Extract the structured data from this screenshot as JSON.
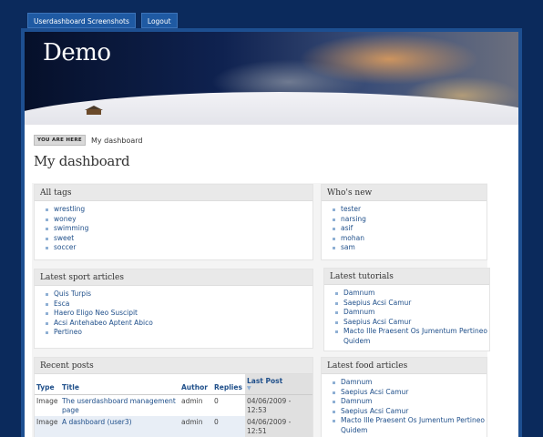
{
  "topnav": {
    "items": [
      {
        "label": "Userdashboard Screenshots"
      },
      {
        "label": "Logout"
      }
    ]
  },
  "site": {
    "title": "Demo"
  },
  "breadcrumb": {
    "tag": "YOU ARE HERE",
    "current": "My dashboard"
  },
  "page": {
    "title": "My dashboard"
  },
  "blocks": {
    "all_tags": {
      "title": "All tags",
      "items": [
        "wrestling",
        "woney",
        "swimming",
        "sweet",
        "soccer"
      ]
    },
    "whos_new": {
      "title": "Who's new",
      "items": [
        "tester",
        "narsing",
        "asif",
        "mohan",
        "sam"
      ]
    },
    "latest_sport": {
      "title": "Latest sport articles",
      "items": [
        "Quis Turpis",
        "Esca",
        "Haero Eligo Neo Suscipit",
        "Acsi Antehabeo Aptent Abico",
        "Pertineo"
      ]
    },
    "latest_tutorials": {
      "title": "Latest tutorials",
      "items": [
        "Damnum",
        "Saepius Acsi Camur",
        "Damnum",
        "Saepius Acsi Camur",
        "Macto Ille Praesent Os Jumentum Pertineo Quidem"
      ]
    },
    "recent_posts": {
      "title": "Recent posts",
      "columns": {
        "type": "Type",
        "title": "Title",
        "author": "Author",
        "replies": "Replies",
        "last_post": "Last Post"
      },
      "sort_indicator": "▼",
      "rows": [
        {
          "type": "Image",
          "title": "The userdashboard management page",
          "author": "admin",
          "replies": "0",
          "last_post": "04/06/2009 - 12:53"
        },
        {
          "type": "Image",
          "title": "A dashboard (user3)",
          "author": "admin",
          "replies": "0",
          "last_post": "04/06/2009 - 12:51"
        }
      ]
    },
    "latest_food": {
      "title": "Latest food articles",
      "items": [
        "Damnum",
        "Saepius Acsi Camur",
        "Damnum",
        "Saepius Acsi Camur",
        "Macto Ille Praesent Os Jumentum Pertineo Quidem"
      ]
    }
  }
}
